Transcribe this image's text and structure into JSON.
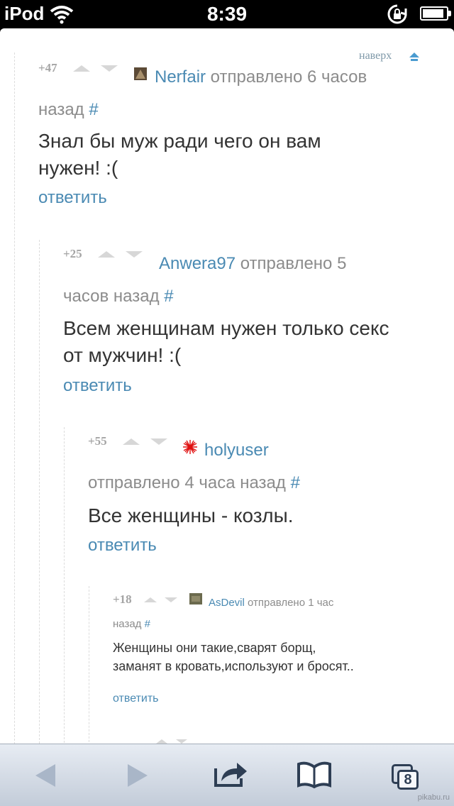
{
  "status_bar": {
    "device": "iPod",
    "time": "8:39",
    "battery_level": 0.9
  },
  "colors": {
    "link": "#4a8ab3",
    "rating": "#a5a5a5",
    "meta": "#8c8c8c",
    "text": "#333333"
  },
  "page": {
    "back_to_top": "наверх"
  },
  "comments": [
    {
      "rating": "+47",
      "username": "Nerfair",
      "meta": " отправлено 6 часов назад ",
      "hash": "#",
      "text": "Знал бы муж ради чего он вам нужен! :(",
      "reply": "ответить"
    },
    {
      "rating": "+25",
      "username": "Anwera97",
      "meta": " отправлено 5 часов назад ",
      "hash": "#",
      "text": "Всем женщинам нужен только секс от мужчин! :(",
      "reply": "ответить"
    },
    {
      "rating": "+55",
      "username": "holyuser",
      "meta": " отправлено 4 часа назад ",
      "hash": "#",
      "text": "Все женщины - козлы.",
      "reply": "ответить"
    },
    {
      "rating": "+18",
      "username": "AsDevil",
      "meta": " отправлено 1 час назад ",
      "hash": "#",
      "text": "Женщины они такие,сварят борщ, заманят в кровать,используют и бросят..",
      "reply": "ответить"
    }
  ],
  "toolbar": {
    "back_icon": "back-arrow-icon",
    "forward_icon": "forward-arrow-icon",
    "share_icon": "share-icon",
    "bookmarks_icon": "bookmarks-book-icon",
    "tabs_icon": "tabs-icon",
    "tabs_count": "8"
  },
  "watermark": "pikabu.ru"
}
